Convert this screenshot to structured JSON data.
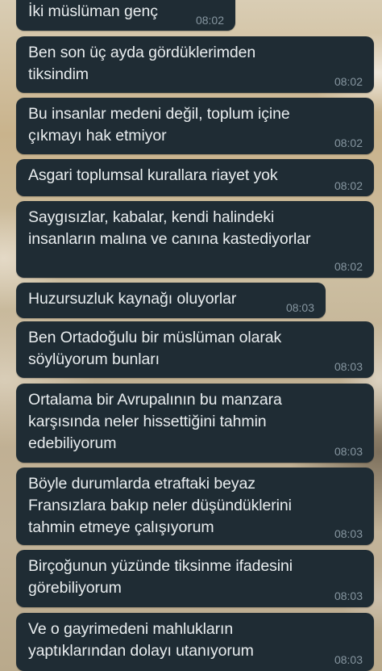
{
  "messages": [
    {
      "text": "İki müslüman genç",
      "time": "08:02"
    },
    {
      "text": "Ben son üç ayda gördüklerimden\ntiksindim",
      "time": "08:02"
    },
    {
      "text": "Bu insanlar medeni değil, toplum içine\nçıkmayı hak etmiyor",
      "time": "08:02"
    },
    {
      "text": "Asgari toplumsal kurallara riayet yok",
      "time": "08:02"
    },
    {
      "text": "Saygısızlar, kabalar, kendi halindeki\ninsanların malına ve canına kastediyorlar",
      "time": "08:02"
    },
    {
      "text": "Huzursuzluk kaynağı oluyorlar",
      "time": "08:03"
    },
    {
      "text": "Ben Ortadoğulu bir müslüman olarak\nsöylüyorum bunları",
      "time": "08:03"
    },
    {
      "text": "Ortalama bir Avrupalının bu manzara\nkarşısında neler hissettiğini tahmin\nedebiliyorum",
      "time": "08:03"
    },
    {
      "text": "Böyle durumlarda etraftaki beyaz\nFransızlara bakıp neler düşündüklerini\ntahmin etmeye çalışıyorum",
      "time": "08:03"
    },
    {
      "text": "Birçoğunun yüzünde tiksinme ifadesini\ngörebiliyorum",
      "time": "08:03"
    },
    {
      "text": "Ve o gayrimedeni mahlukların\nyaptıklarından dolayı utanıyorum",
      "time": "08:03"
    }
  ]
}
